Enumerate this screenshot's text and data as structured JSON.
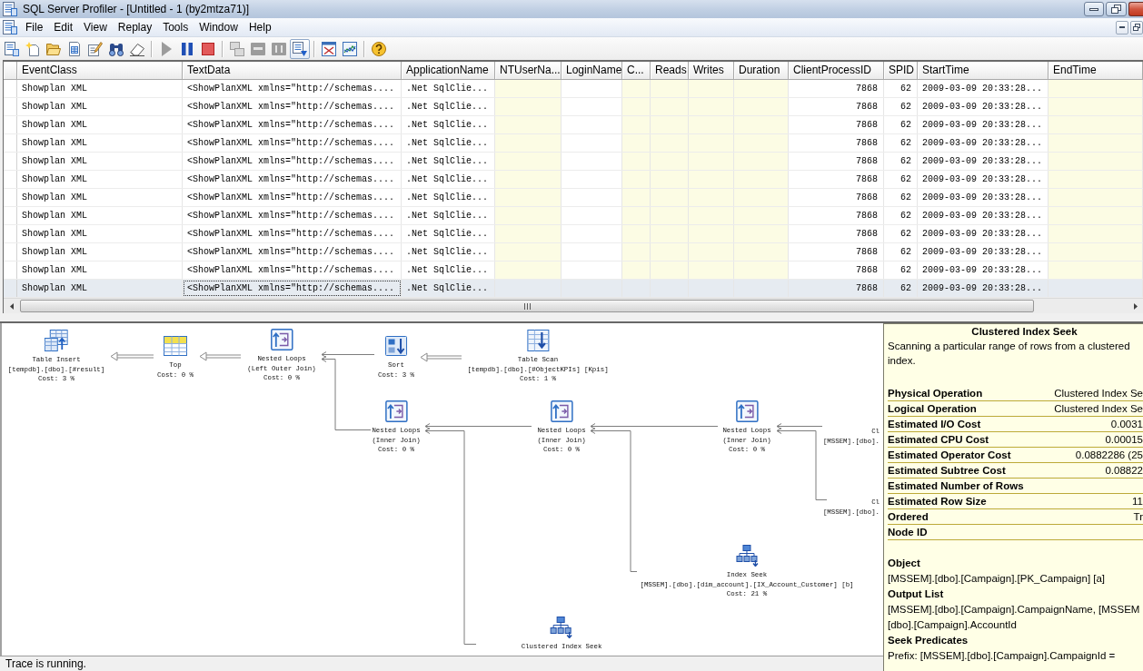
{
  "window": {
    "title": "SQL Server Profiler - [Untitled - 1 (by2mtza71)]"
  },
  "menu": [
    "File",
    "Edit",
    "View",
    "Replay",
    "Tools",
    "Window",
    "Help"
  ],
  "toolbar": [
    {
      "kind": "properties",
      "disabled": false,
      "pressed": false
    },
    {
      "kind": "new",
      "disabled": false,
      "pressed": false
    },
    {
      "kind": "open",
      "disabled": false,
      "pressed": false
    },
    {
      "kind": "template",
      "disabled": false,
      "pressed": false
    },
    {
      "kind": "edit",
      "disabled": false,
      "pressed": false
    },
    {
      "kind": "find",
      "disabled": false,
      "pressed": false
    },
    {
      "kind": "clear",
      "disabled": false,
      "pressed": false
    },
    {
      "kind": "separator"
    },
    {
      "kind": "run",
      "disabled": true,
      "pressed": false
    },
    {
      "kind": "pause",
      "disabled": false,
      "pressed": false
    },
    {
      "kind": "stop",
      "disabled": false,
      "pressed": false
    },
    {
      "kind": "separator"
    },
    {
      "kind": "windows",
      "disabled": true,
      "pressed": false
    },
    {
      "kind": "bar",
      "disabled": true,
      "pressed": false
    },
    {
      "kind": "text",
      "disabled": true,
      "pressed": false
    },
    {
      "kind": "scroll",
      "disabled": false,
      "pressed": true
    },
    {
      "kind": "separator"
    },
    {
      "kind": "cross",
      "disabled": false,
      "pressed": false
    },
    {
      "kind": "chart",
      "disabled": false,
      "pressed": false
    },
    {
      "kind": "separator"
    },
    {
      "kind": "help",
      "disabled": false,
      "pressed": false
    }
  ],
  "grid": {
    "columns": [
      {
        "label": "EventClass",
        "shaded": false
      },
      {
        "label": "TextData",
        "shaded": false
      },
      {
        "label": "ApplicationName",
        "shaded": false
      },
      {
        "label": "NTUserNa...",
        "shaded": true
      },
      {
        "label": "LoginName",
        "shaded": false
      },
      {
        "label": "C...",
        "shaded": true
      },
      {
        "label": "Reads",
        "shaded": true
      },
      {
        "label": "Writes",
        "shaded": true
      },
      {
        "label": "Duration",
        "shaded": true
      },
      {
        "label": "ClientProcessID",
        "shaded": false
      },
      {
        "label": "SPID",
        "shaded": false
      },
      {
        "label": "StartTime",
        "shaded": false
      },
      {
        "label": "EndTime",
        "shaded": true
      }
    ],
    "rows": [
      {
        "selected": false,
        "event_class": "Showplan XML",
        "text_data": "<ShowPlanXML xmlns=\"http://schemas....",
        "application_name": ".Net SqlClie...",
        "client_process_id": "7868",
        "spid": "62",
        "start_time": "2009-03-09 20:33:28..."
      },
      {
        "selected": false,
        "event_class": "Showplan XML",
        "text_data": "<ShowPlanXML xmlns=\"http://schemas....",
        "application_name": ".Net SqlClie...",
        "client_process_id": "7868",
        "spid": "62",
        "start_time": "2009-03-09 20:33:28..."
      },
      {
        "selected": false,
        "event_class": "Showplan XML",
        "text_data": "<ShowPlanXML xmlns=\"http://schemas....",
        "application_name": ".Net SqlClie...",
        "client_process_id": "7868",
        "spid": "62",
        "start_time": "2009-03-09 20:33:28..."
      },
      {
        "selected": false,
        "event_class": "Showplan XML",
        "text_data": "<ShowPlanXML xmlns=\"http://schemas....",
        "application_name": ".Net SqlClie...",
        "client_process_id": "7868",
        "spid": "62",
        "start_time": "2009-03-09 20:33:28..."
      },
      {
        "selected": false,
        "event_class": "Showplan XML",
        "text_data": "<ShowPlanXML xmlns=\"http://schemas....",
        "application_name": ".Net SqlClie...",
        "client_process_id": "7868",
        "spid": "62",
        "start_time": "2009-03-09 20:33:28..."
      },
      {
        "selected": false,
        "event_class": "Showplan XML",
        "text_data": "<ShowPlanXML xmlns=\"http://schemas....",
        "application_name": ".Net SqlClie...",
        "client_process_id": "7868",
        "spid": "62",
        "start_time": "2009-03-09 20:33:28..."
      },
      {
        "selected": false,
        "event_class": "Showplan XML",
        "text_data": "<ShowPlanXML xmlns=\"http://schemas....",
        "application_name": ".Net SqlClie...",
        "client_process_id": "7868",
        "spid": "62",
        "start_time": "2009-03-09 20:33:28..."
      },
      {
        "selected": false,
        "event_class": "Showplan XML",
        "text_data": "<ShowPlanXML xmlns=\"http://schemas....",
        "application_name": ".Net SqlClie...",
        "client_process_id": "7868",
        "spid": "62",
        "start_time": "2009-03-09 20:33:28..."
      },
      {
        "selected": false,
        "event_class": "Showplan XML",
        "text_data": "<ShowPlanXML xmlns=\"http://schemas....",
        "application_name": ".Net SqlClie...",
        "client_process_id": "7868",
        "spid": "62",
        "start_time": "2009-03-09 20:33:28..."
      },
      {
        "selected": false,
        "event_class": "Showplan XML",
        "text_data": "<ShowPlanXML xmlns=\"http://schemas....",
        "application_name": ".Net SqlClie...",
        "client_process_id": "7868",
        "spid": "62",
        "start_time": "2009-03-09 20:33:28..."
      },
      {
        "selected": false,
        "event_class": "Showplan XML",
        "text_data": "<ShowPlanXML xmlns=\"http://schemas....",
        "application_name": ".Net SqlClie...",
        "client_process_id": "7868",
        "spid": "62",
        "start_time": "2009-03-09 20:33:28..."
      },
      {
        "selected": true,
        "event_class": "Showplan XML",
        "text_data": "<ShowPlanXML xmlns=\"http://schemas....",
        "application_name": ".Net SqlClie...",
        "client_process_id": "7868",
        "spid": "62",
        "start_time": "2009-03-09 20:33:28..."
      }
    ]
  },
  "plan": {
    "nodes": [
      {
        "kind": "insert",
        "operator": "Table Insert",
        "details": [
          "[tempdb].[dbo].[#result]"
        ],
        "cost": "Cost: 3 %"
      },
      {
        "kind": "top",
        "operator": "Top",
        "cost": "Cost: 0 %"
      },
      {
        "kind": "loops",
        "operator": "Nested Loops",
        "details": [
          "(Left Outer Join)"
        ],
        "cost": "Cost: 0 %"
      },
      {
        "kind": "sort",
        "operator": "Sort",
        "cost": "Cost: 3 %"
      },
      {
        "kind": "scan",
        "operator": "Table Scan",
        "details": [
          "[tempdb].[dbo].[#ObjectKPIs] [Kpis]"
        ],
        "cost": "Cost: 1 %"
      },
      {
        "kind": "loops",
        "operator": "Nested Loops",
        "details": [
          "(Inner Join)"
        ],
        "cost": "Cost: 0 %"
      },
      {
        "kind": "loops",
        "operator": "Nested Loops",
        "details": [
          "(Inner Join)"
        ],
        "cost": "Cost: 0 %"
      },
      {
        "kind": "loops",
        "operator": "Nested Loops",
        "details": [
          "(Inner Join)"
        ],
        "cost": "Cost: 0 %"
      },
      {
        "kind": "partial",
        "operator": "Cl",
        "details": [
          "[MSSEM].[dbo]."
        ]
      },
      {
        "kind": "partial",
        "operator": "Cl",
        "details": [
          "[MSSEM].[dbo]."
        ]
      },
      {
        "kind": "seek",
        "operator": "Index Seek",
        "details": [
          "[MSSEM].[dbo].[dim_account].[IX_Account_Customer] [b]"
        ],
        "cost": "Cost: 21 %"
      },
      {
        "kind": "clustered",
        "operator": "Clustered Index Seek"
      }
    ]
  },
  "tooltip": {
    "title": "Clustered Index Seek",
    "description": "Scanning a particular range of rows from a clustered index.",
    "properties": [
      {
        "label": "Physical Operation",
        "value": "Clustered Index Se"
      },
      {
        "label": "Logical Operation",
        "value": "Clustered Index Se"
      },
      {
        "label": "Estimated I/O Cost",
        "value": "0.0031"
      },
      {
        "label": "Estimated CPU Cost",
        "value": "0.00015"
      },
      {
        "label": "Estimated Operator Cost",
        "value": "0.0882286 (25"
      },
      {
        "label": "Estimated Subtree Cost",
        "value": "0.08822"
      },
      {
        "label": "Estimated Number of Rows"
      },
      {
        "label": "Estimated Row Size",
        "value": "11"
      },
      {
        "label": "Ordered",
        "value": "Tr"
      },
      {
        "label": "Node ID"
      }
    ],
    "sections": [
      {
        "heading": "Object",
        "lines": [
          "[MSSEM].[dbo].[Campaign].[PK_Campaign] [a]"
        ]
      },
      {
        "heading": "Output List",
        "lines": [
          "[MSSEM].[dbo].[Campaign].CampaignName, [MSSEM",
          "[dbo].[Campaign].AccountId"
        ]
      },
      {
        "heading": "Seek Predicates",
        "lines": [
          "Prefix: [MSSEM].[dbo].[Campaign].CampaignId ="
        ]
      }
    ]
  },
  "status_bar": {
    "text": "Trace is running."
  }
}
